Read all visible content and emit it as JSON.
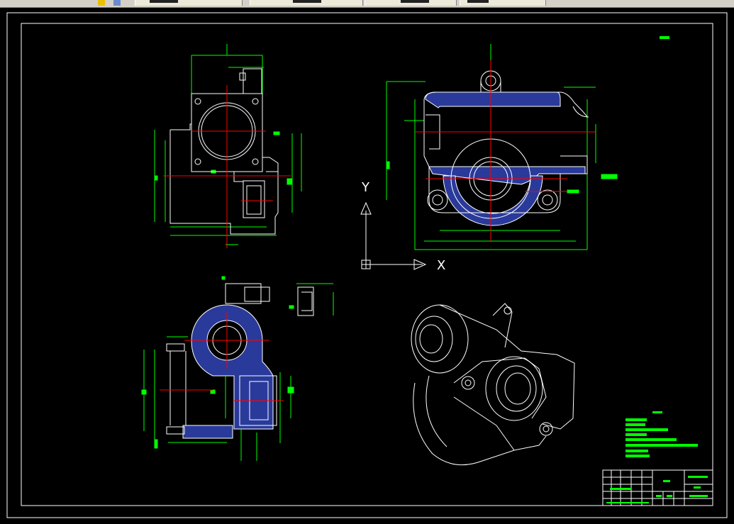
{
  "toolbar": {
    "tabs": [
      "",
      "",
      "",
      ""
    ],
    "icons": [
      "tool-icon-1",
      "tool-icon-2"
    ]
  },
  "colors": {
    "background": "#000000",
    "geometry": "#ffffff",
    "dimension": "#00ff00",
    "centerline": "#ff0000",
    "hatch": "#3040a0"
  },
  "ucs": {
    "x_label": "X",
    "y_label": "Y"
  },
  "tech_requirements": {
    "lines": 7
  },
  "title_block": {
    "rows": 5
  }
}
